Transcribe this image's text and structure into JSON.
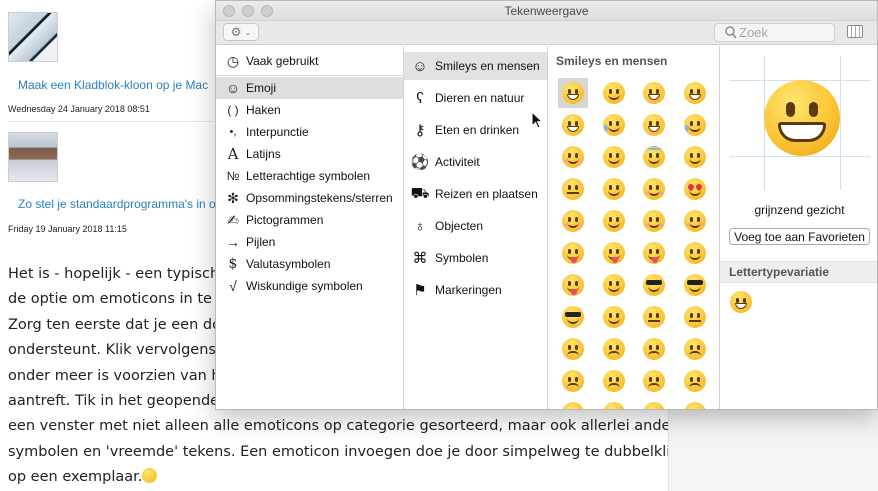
{
  "page": {
    "articles": [
      {
        "title": "Maak een Kladblok-kloon op je Mac",
        "date": "Wednesday 24 January 2018 08:51"
      },
      {
        "title": "Zo stel je standaardprogramma's in o",
        "date": "Friday 19 January 2018 11:15"
      }
    ],
    "body_lines": [
      "Het is - hopelijk - een typisch be",
      "de optie om emoticons in te voe",
      "Zorg ten eerste dat je een docu",
      "ondersteunt. Klik vervolgens he",
      "onder meer is voorzien van het",
      "aantreft. Tik in het geopende m",
      "een venster met niet alleen alle emoticons op categorie gesorteerd, maar ook allerlei andere",
      "symbolen en 'vreemde' tekens. Een emoticon invoegen doe je door simpelweg te dubbelklikken",
      "op een exemplaar."
    ]
  },
  "viewer": {
    "title": "Tekenweergave",
    "search_placeholder": "Zoek",
    "categories": [
      {
        "icon": "clock-icon",
        "glyph": "◷",
        "label": "Vaak gebruikt"
      },
      {
        "icon": "smiley-icon",
        "glyph": "☺",
        "label": "Emoji",
        "selected": true
      },
      {
        "icon": "parentheses-icon",
        "glyph": "( )",
        "label": "Haken"
      },
      {
        "icon": "punctuation-icon",
        "glyph": "•,",
        "label": "Interpunctie"
      },
      {
        "icon": "latin-icon",
        "glyph": "A",
        "label": "Latijns"
      },
      {
        "icon": "numero-icon",
        "glyph": "№",
        "label": "Letterachtige symbolen"
      },
      {
        "icon": "asterisk-icon",
        "glyph": "✻",
        "label": "Opsommingstekens/sterren"
      },
      {
        "icon": "pictogram-icon",
        "glyph": "✍",
        "label": "Pictogrammen"
      },
      {
        "icon": "arrow-icon",
        "glyph": "→",
        "label": "Pijlen"
      },
      {
        "icon": "dollar-icon",
        "glyph": "$",
        "label": "Valutasymbolen"
      },
      {
        "icon": "sqrt-icon",
        "glyph": "√",
        "label": "Wiskundige symbolen"
      }
    ],
    "subcategories": [
      {
        "icon": "smiley-icon",
        "glyph": "☺",
        "label": "Smileys en mensen",
        "selected": true
      },
      {
        "icon": "bear-icon",
        "glyph": "ʕ",
        "label": "Dieren en natuur"
      },
      {
        "icon": "cutlery-icon",
        "glyph": "⚷",
        "label": "Eten en drinken"
      },
      {
        "icon": "ball-icon",
        "glyph": "⚽",
        "label": "Activiteit"
      },
      {
        "icon": "car-icon",
        "glyph": "⛟",
        "label": "Reizen en plaatsen"
      },
      {
        "icon": "bulb-icon",
        "glyph": "♁",
        "label": "Objecten"
      },
      {
        "icon": "symbols-icon",
        "glyph": "⌘",
        "label": "Symbolen"
      },
      {
        "icon": "flag-icon",
        "glyph": "⚑",
        "label": "Markeringen"
      }
    ],
    "grid_heading": "Smileys en mensen",
    "preview_name": "grijnzend gezicht",
    "favorite_button": "Voeg toe aan Favorieten",
    "variant_heading": "Lettertypevariatie"
  }
}
